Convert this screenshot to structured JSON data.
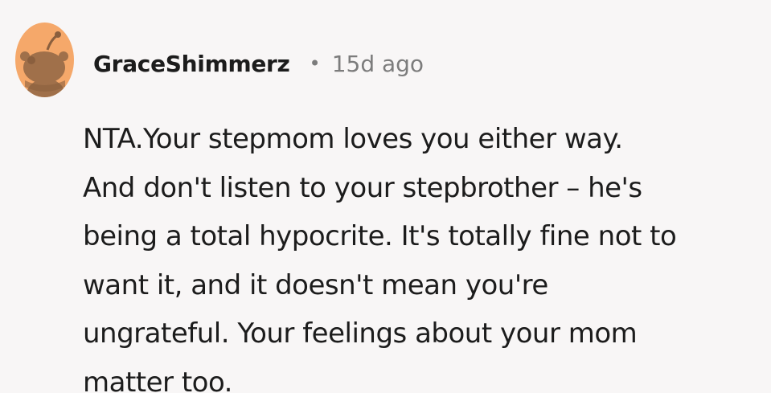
{
  "comment": {
    "author": "GraceShimmerz",
    "separator": "•",
    "timestamp": "15d ago",
    "avatar_icon": "snoo-avatar-icon",
    "avatar_colors": {
      "background": "#f5a86a",
      "figure": "#a0704a",
      "figure_dark": "#8a5f3e"
    },
    "body_lines": [
      "NTA.Your stepmom loves you either way.",
      "And don't listen to your stepbrother – he's",
      "being a total hypocrite. It's totally fine not to",
      "want it, and it doesn't mean you're",
      "ungrateful. Your feelings about your mom",
      "matter too."
    ]
  }
}
